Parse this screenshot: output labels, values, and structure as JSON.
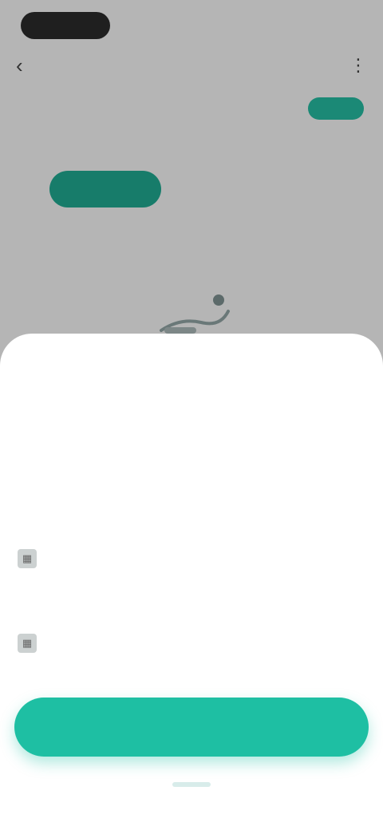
{
  "status_bar": {
    "time": "",
    "icons": ""
  },
  "nav": {
    "back_icon": "chevron-left-icon",
    "title": "",
    "more_icon": "more-icon"
  },
  "info": {
    "label": "",
    "sub": "",
    "button": "",
    "button_sub": ""
  },
  "tabs": [
    {
      "label": ""
    },
    {
      "label": ""
    },
    {
      "label": ""
    }
  ],
  "sheet": {
    "title": "",
    "options": [
      "",
      "",
      "",
      "",
      "",
      ""
    ],
    "field1": {
      "label": "",
      "value": ""
    },
    "field2": {
      "label": "",
      "value": ""
    },
    "confirm": ""
  },
  "colors": {
    "accent": "#1ebfa3",
    "accent_dark": "#1fa88f"
  }
}
